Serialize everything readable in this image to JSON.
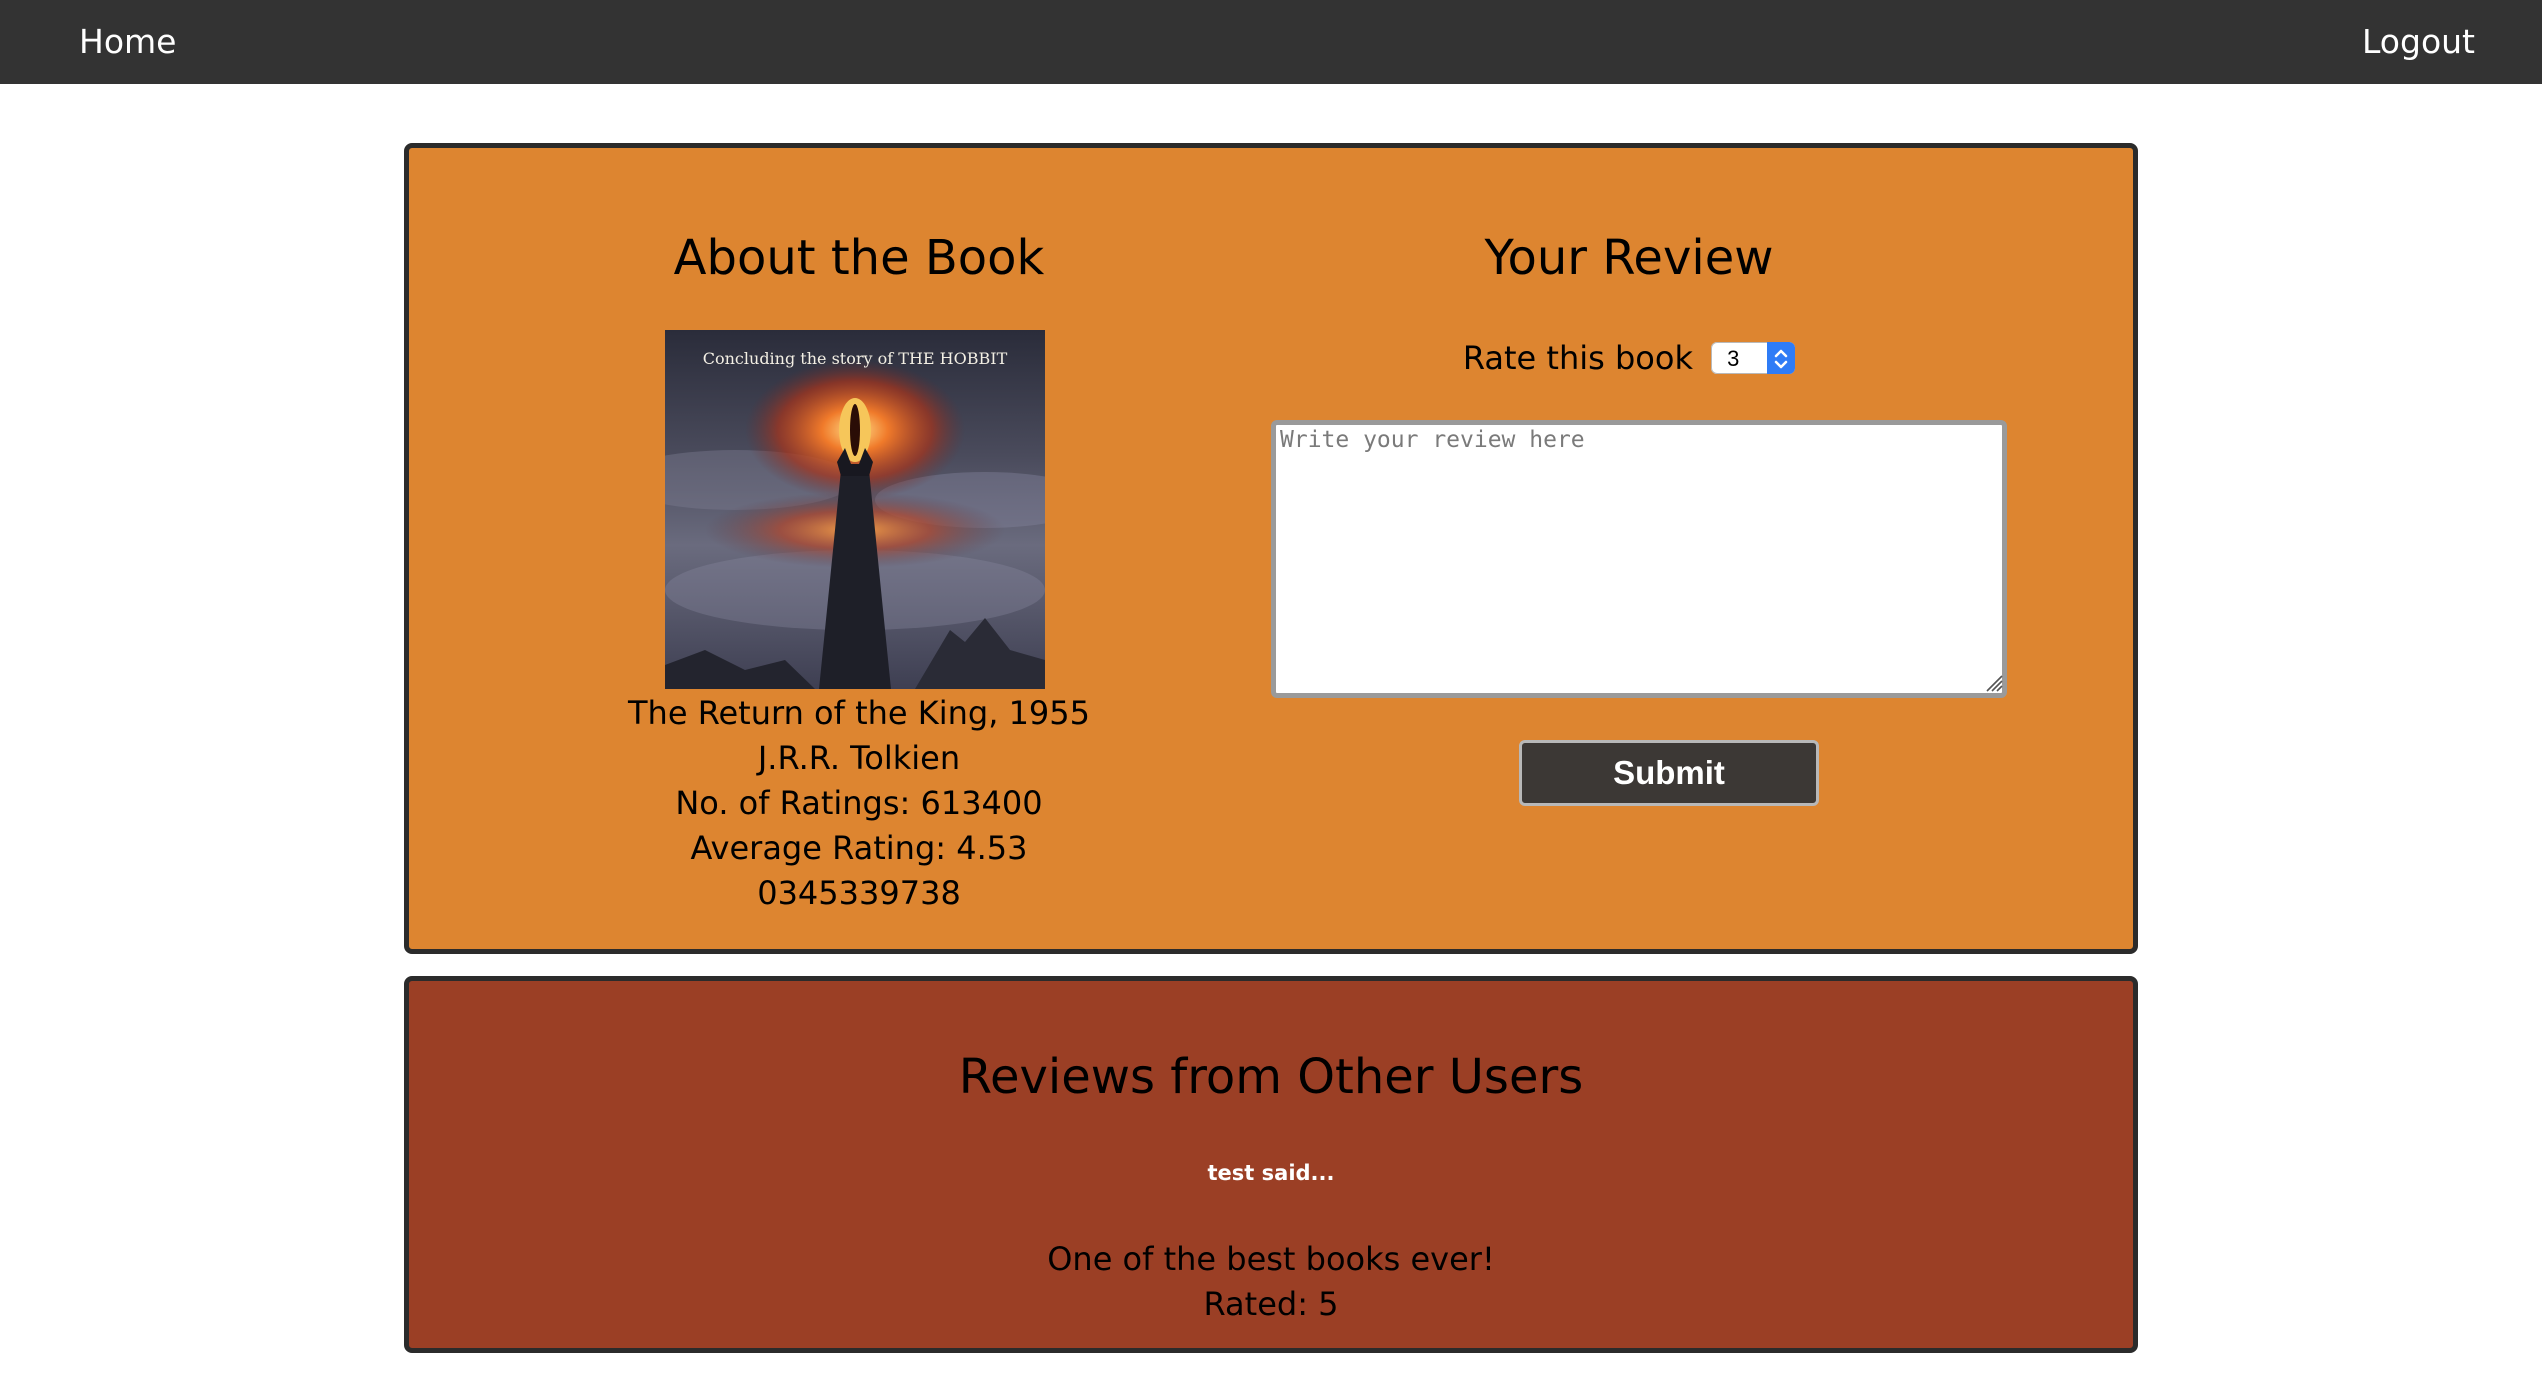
{
  "nav": {
    "home_label": "Home",
    "logout_label": "Logout"
  },
  "book": {
    "heading": "About the Book",
    "cover": {
      "caption": "Concluding the story of THE HOBBIT"
    },
    "title_year": "The Return of the King, 1955",
    "author": "J.R.R. Tolkien",
    "ratings_count": "No. of Ratings: 613400",
    "average_rating": "Average Rating: 4.53",
    "isbn": "0345339738"
  },
  "review_form": {
    "heading": "Your Review",
    "rate_label": "Rate this book",
    "rate_value": "3",
    "textarea_placeholder": "Write your review here",
    "submit_label": "Submit"
  },
  "other_reviews": {
    "heading": "Reviews from Other Users",
    "items": [
      {
        "author_line": "test said...",
        "text": "One of the best books ever!",
        "rating_line": "Rated: 5"
      }
    ]
  },
  "colors": {
    "navbar": "#333333",
    "book_panel": "#dd8530",
    "reviews_panel": "#9b3f25",
    "submit_button": "#3c3835",
    "select_accent": "#2f7cf6"
  }
}
